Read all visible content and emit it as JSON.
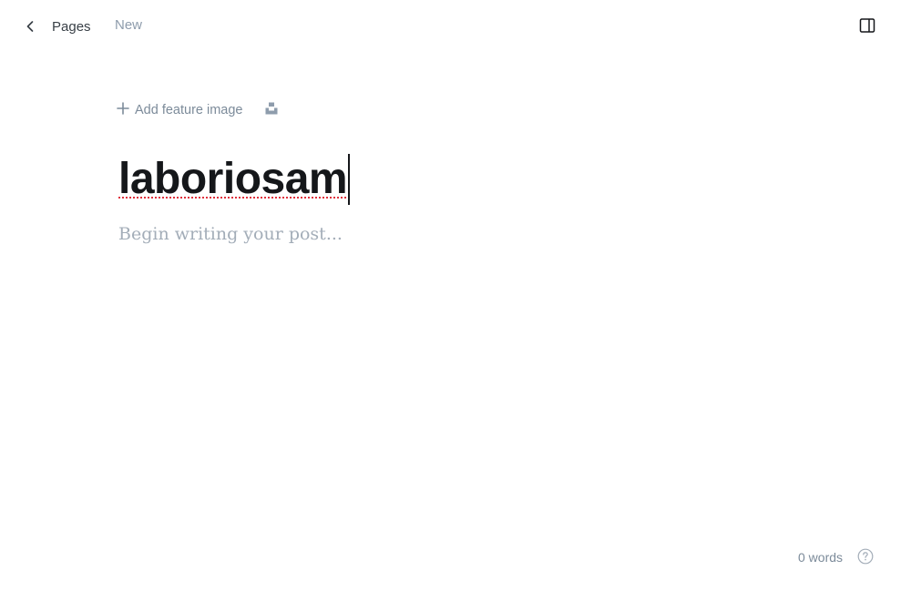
{
  "header": {
    "back_icon": "chevron-left-icon",
    "back_label": "Pages",
    "status": "New",
    "sidebar_toggle_icon": "sidebar-panel-icon"
  },
  "feature_image": {
    "add_icon": "plus-icon",
    "add_label": "Add feature image",
    "unsplash_icon": "unsplash-icon"
  },
  "editor": {
    "title": "laboriosam",
    "body_placeholder": "Begin writing your post..."
  },
  "footer": {
    "word_count": "0 words",
    "help_icon": "help-circle-icon"
  },
  "colors": {
    "text_primary": "#15171a",
    "text_muted": "#8e9cac",
    "spellcheck_underline": "#e0313d"
  }
}
